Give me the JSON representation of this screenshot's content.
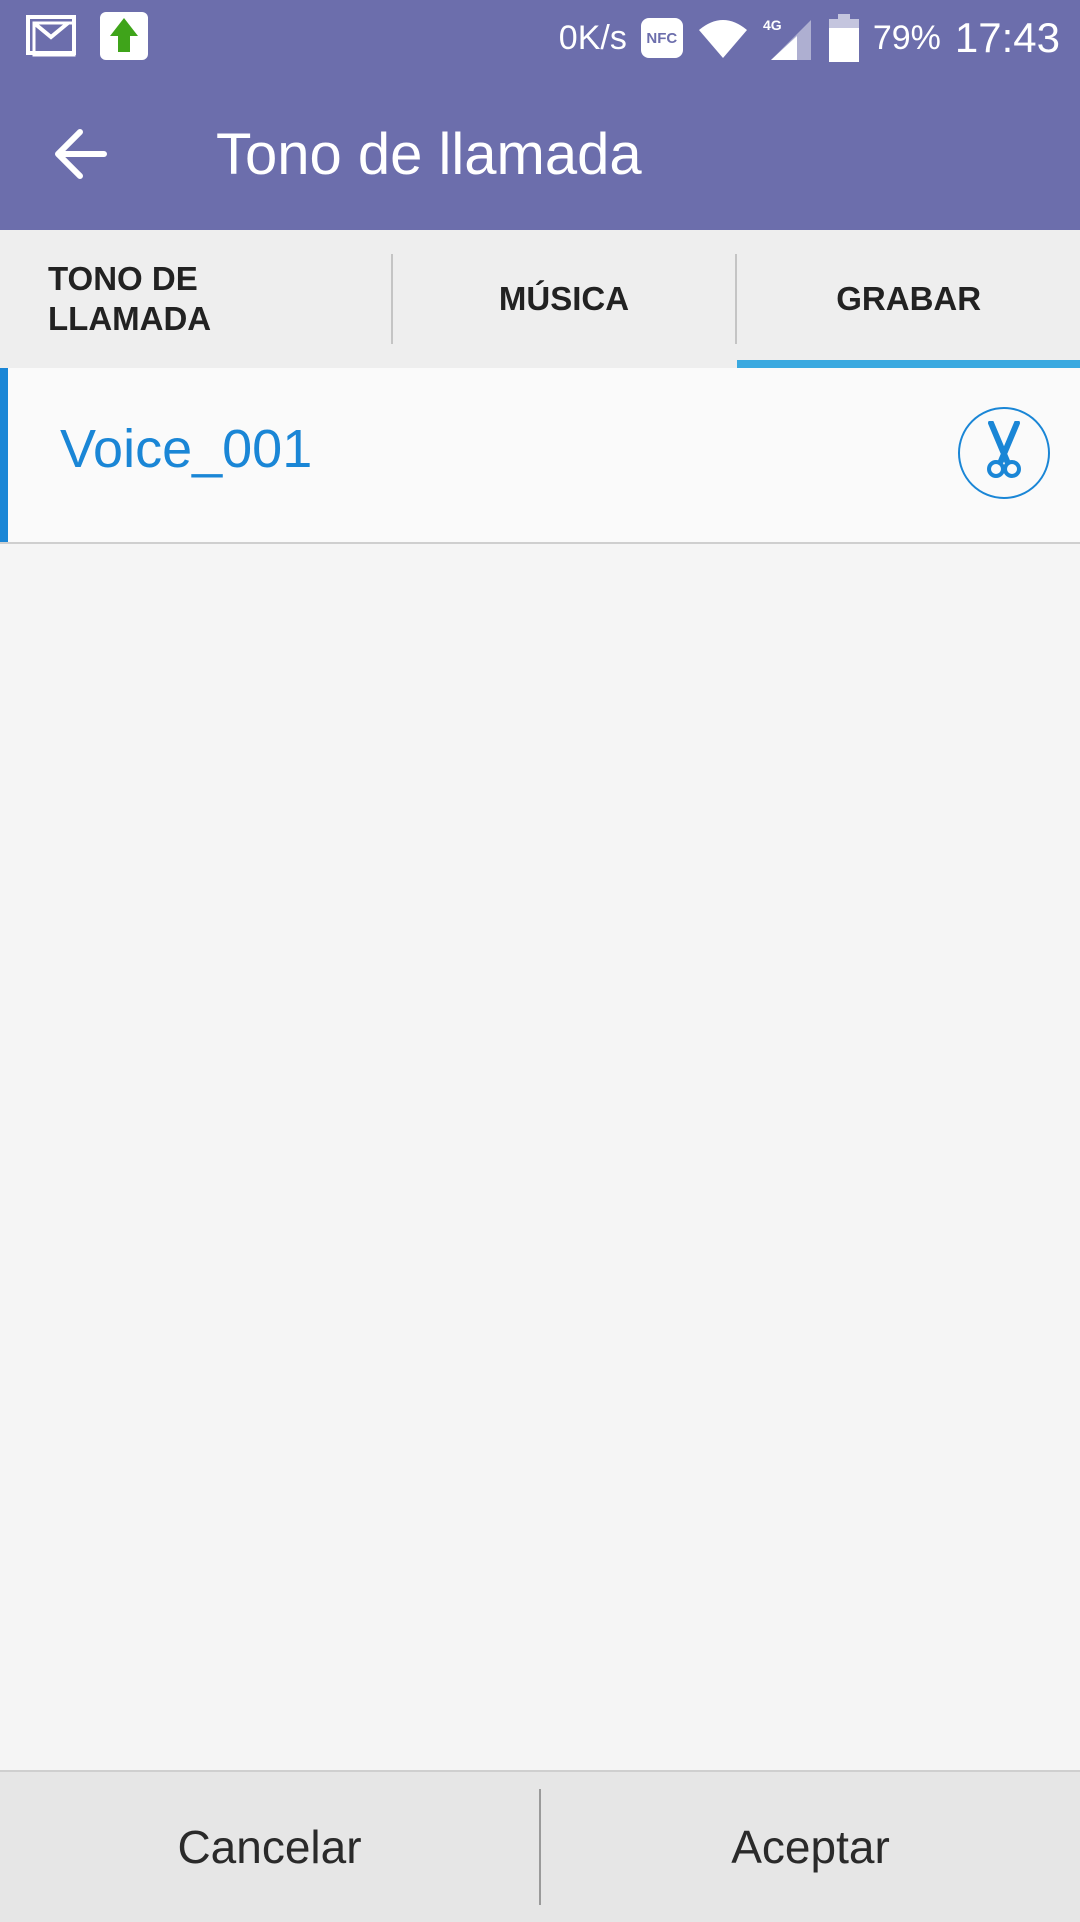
{
  "status_bar": {
    "icons_left": [
      "gmail-icon",
      "upload-icon"
    ],
    "net_speed": "0K/s",
    "nfc_label": "NFC",
    "network_type": "4G",
    "battery": "79%",
    "time": "17:43"
  },
  "app_bar": {
    "title": "Tono de llamada",
    "back_icon": "arrow-left-icon"
  },
  "tabs": [
    {
      "label": "TONO DE LLAMADA",
      "line1": "TONO DE",
      "line2": "LLAMADA",
      "active": false
    },
    {
      "label": "MÚSICA",
      "active": false
    },
    {
      "label": "GRABAR",
      "active": true
    }
  ],
  "list": {
    "items": [
      {
        "label": "Voice_001",
        "selected": true,
        "action_icon": "scissors-icon"
      }
    ]
  },
  "bottom_bar": {
    "cancel_label": "Cancelar",
    "accept_label": "Aceptar"
  },
  "colors": {
    "header": "#6c6eac",
    "accent": "#1a86d6",
    "tab_indicator": "#3aa9e0"
  }
}
